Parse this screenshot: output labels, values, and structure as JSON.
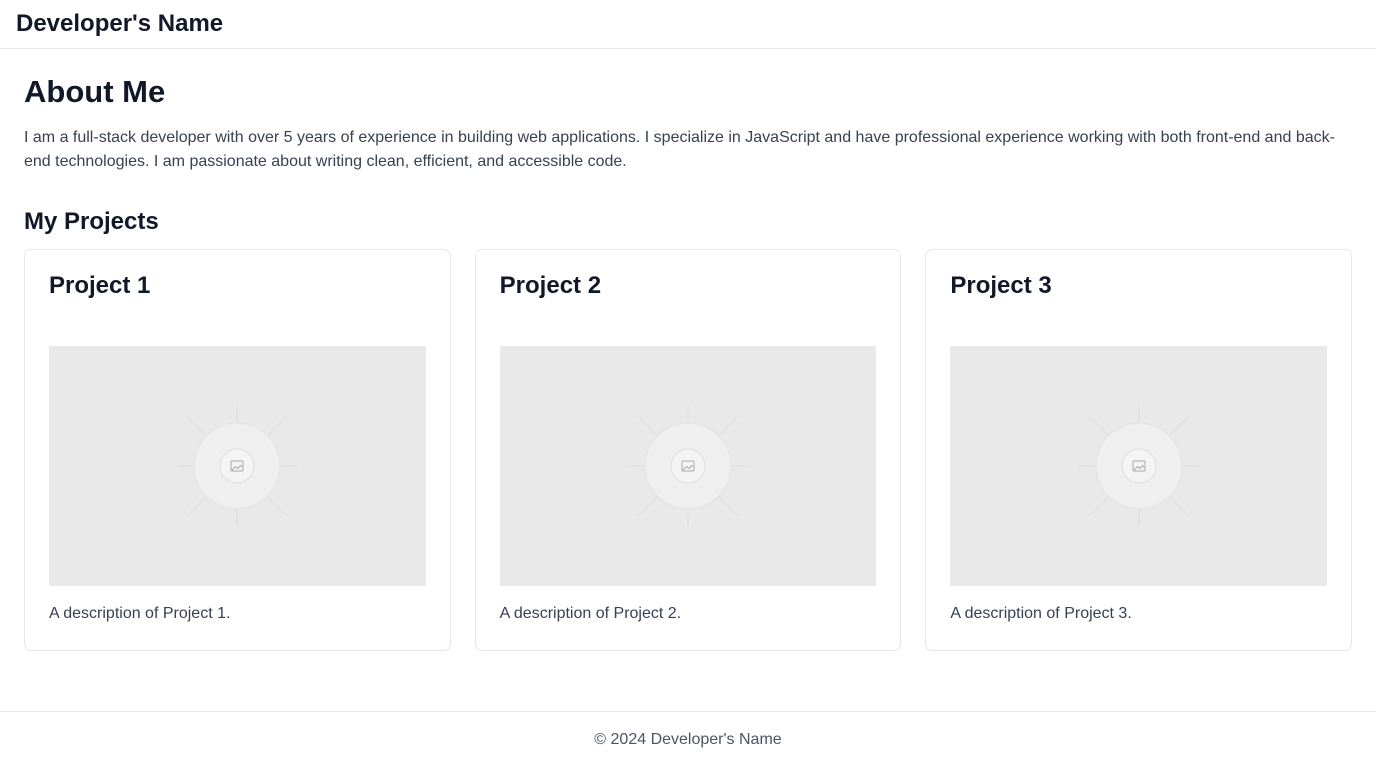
{
  "header": {
    "site_name": "Developer's Name"
  },
  "about": {
    "title": "About Me",
    "text": "I am a full-stack developer with over 5 years of experience in building web applications. I specialize in JavaScript and have professional experience working with both front-end and back-end technologies. I am passionate about writing clean, efficient, and accessible code."
  },
  "projects": {
    "title": "My Projects",
    "items": [
      {
        "title": "Project 1",
        "description": "A description of Project 1.",
        "image_icon": "image-placeholder-icon"
      },
      {
        "title": "Project 2",
        "description": "A description of Project 2.",
        "image_icon": "image-placeholder-icon"
      },
      {
        "title": "Project 3",
        "description": "A description of Project 3.",
        "image_icon": "image-placeholder-icon"
      }
    ]
  },
  "footer": {
    "text": "© 2024 Developer's Name"
  },
  "colors": {
    "text_primary": "#111827",
    "text_secondary": "#374151",
    "border": "#e5e7eb",
    "image_placeholder_bg": "#e9e9e9"
  }
}
